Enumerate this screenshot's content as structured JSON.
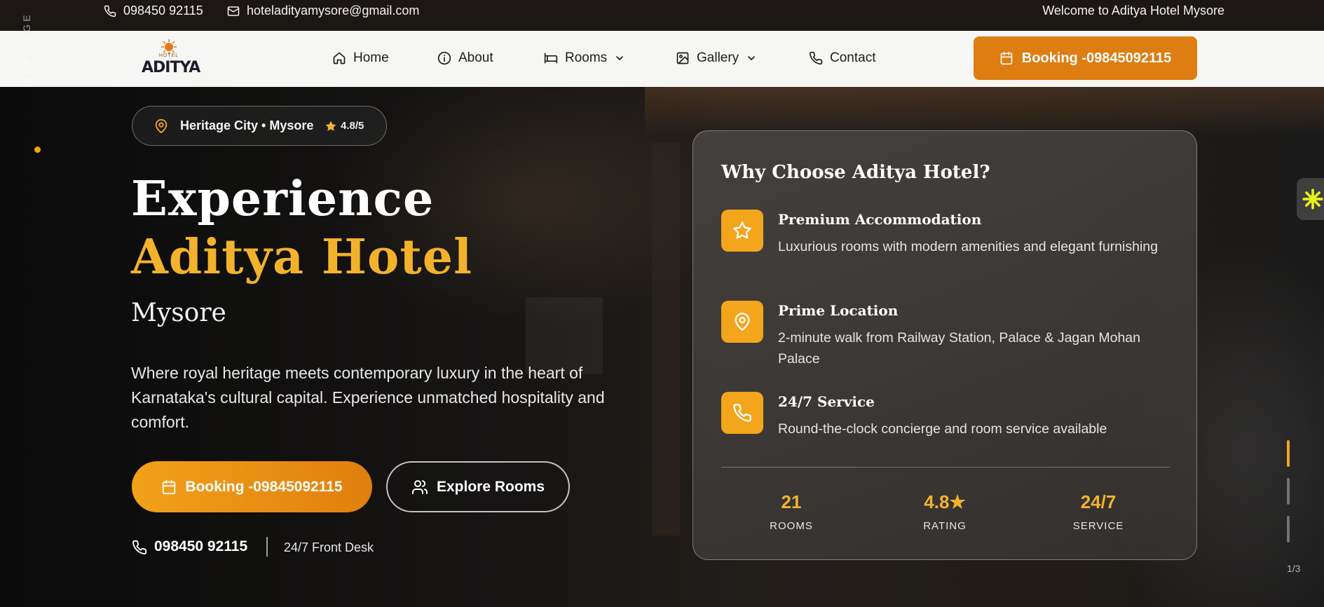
{
  "topbar": {
    "phone": "098450 92115",
    "email": "hoteladityamysore@gmail.com",
    "welcome": "Welcome to Aditya Hotel Mysore"
  },
  "nav": {
    "logo_small": "HOTEL",
    "logo_brand": "ADITYA",
    "items": [
      {
        "label": "Home",
        "icon": "home-icon"
      },
      {
        "label": "About",
        "icon": "info-icon"
      },
      {
        "label": "Rooms",
        "icon": "bed-icon",
        "dropdown": true
      },
      {
        "label": "Gallery",
        "icon": "image-icon",
        "dropdown": true
      },
      {
        "label": "Contact",
        "icon": "phone-icon"
      }
    ],
    "booking_label": "Booking -09845092115"
  },
  "hero": {
    "vertical_text": "HERITAGE",
    "location": "Heritage City • Mysore",
    "rating": "4.8/5",
    "title_line1": "Experience",
    "title_line2": "Aditya Hotel",
    "subtitle": "Mysore",
    "description": "Where royal heritage meets contemporary luxury in the heart of Karnataka's cultural capital. Experience unmatched hospitality and comfort.",
    "booking_label": "Booking -09845092115",
    "explore_label": "Explore Rooms",
    "phone": "098450 92115",
    "front_desk": "24/7 Front Desk",
    "slide_counter": "1/3"
  },
  "card": {
    "title": "Why Choose Aditya Hotel?",
    "features": [
      {
        "icon": "star-icon",
        "title": "Premium Accommodation",
        "desc": "Luxurious rooms with modern amenities and elegant furnishing"
      },
      {
        "icon": "location-pin-icon",
        "title": "Prime Location",
        "desc": "2-minute walk from Railway Station, Palace & Jagan Mohan Palace"
      },
      {
        "icon": "phone-icon",
        "title": "24/7 Service",
        "desc": "Round-the-clock concierge and room service available"
      }
    ],
    "stats": [
      {
        "value": "21",
        "label": "ROOMS"
      },
      {
        "value": "4.8★",
        "label": "RATING"
      },
      {
        "value": "24/7",
        "label": "SERVICE"
      }
    ]
  },
  "colors": {
    "accent": "#f3a51b",
    "accent_dark": "#dd7d12",
    "gold_text": "#f3b22c",
    "topbar_bg": "#1c1714",
    "nav_bg": "#f6f6f4"
  }
}
